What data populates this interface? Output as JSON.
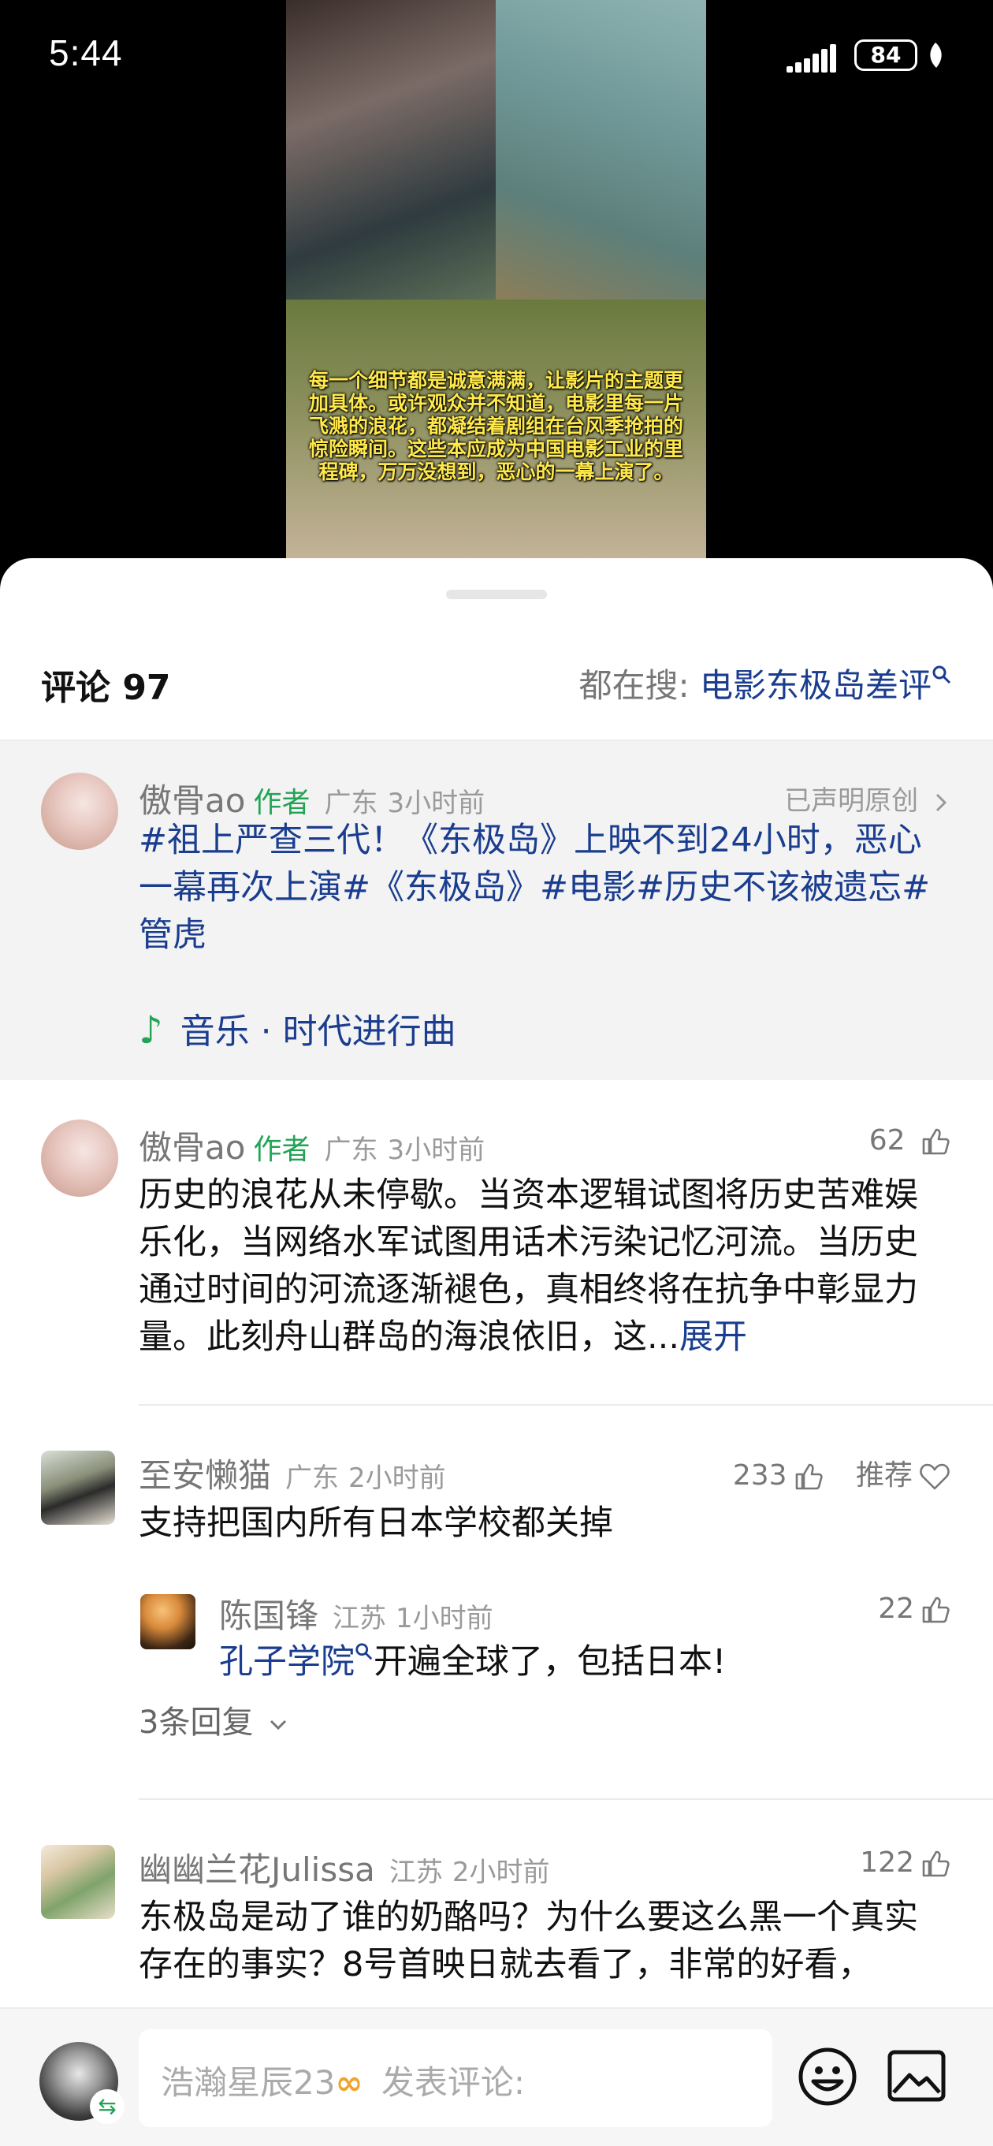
{
  "status_bar": {
    "time": "5:44",
    "battery": "84"
  },
  "video": {
    "caption": "每一个细节都是诚意满满，让影片的主题更加具体。或许观众并不知道，电影里每一片飞溅的浪花，都凝结着剧组在台风季抢拍的惊险瞬间。这些本应成为中国电影工业的里程碑，万万没想到，恶心的一幕上演了。"
  },
  "header": {
    "comment_count_label": "评论 97",
    "search_prefix": "都在搜: ",
    "search_query": "电影东极岛差评"
  },
  "pinned": {
    "name": "傲骨ao",
    "author_tag": "作者",
    "location": "广东",
    "time": "3小时前",
    "declared": "已声明原创",
    "text_prefix": "#祖上严查三代！《东极岛》上映不到24小时，恶心一幕再次上演",
    "hashtags": "#《东极岛》#电影#历史不该被遗忘#管虎",
    "music_label": "音乐 · 时代进行曲"
  },
  "comments": [
    {
      "name": "傲骨ao",
      "author_tag": "作者",
      "location": "广东",
      "time": "3小时前",
      "likes": "62",
      "text": "历史的浪花从未停歇。当资本逻辑试图将历史苦难娱乐化，当网络水军试图用话术污染记忆河流。当历史通过时间的河流逐渐褪色，真相终将在抗争中彰显力量。此刻舟山群岛的海浪依旧，这...",
      "expand": "展开"
    },
    {
      "name": "至安懒猫",
      "location": "广东",
      "time": "2小时前",
      "likes": "233",
      "recommend": "推荐",
      "text": "支持把国内所有日本学校都关掉",
      "reply": {
        "name": "陈国锋",
        "location": "江苏",
        "time": "1小时前",
        "likes": "22",
        "link": "孔子学院",
        "text": "开遍全球了，包括日本!"
      },
      "reply_count": "3条回复"
    },
    {
      "name": "幽幽兰花Julissa",
      "location": "江苏",
      "time": "2小时前",
      "likes": "122",
      "text": "东极岛是动了谁的奶酪吗？为什么要这么黑一个真实存在的事实？8号首映日就去看了，非常的好看，"
    }
  ],
  "bottom_bar": {
    "username": "浩瀚星辰23",
    "input_placeholder": "发表评论:"
  },
  "colors": {
    "accent_link": "#1a3d8f",
    "author_green": "#23a455",
    "caption_yellow": "#ffe94a"
  },
  "icons": [
    "thumb-up-icon",
    "heart-icon",
    "search-icon",
    "music-note-icon",
    "chevron-right-icon",
    "chevron-down-icon",
    "emoji-icon",
    "image-icon",
    "swap-icon",
    "signal-icon",
    "battery-icon",
    "leaf-icon"
  ]
}
